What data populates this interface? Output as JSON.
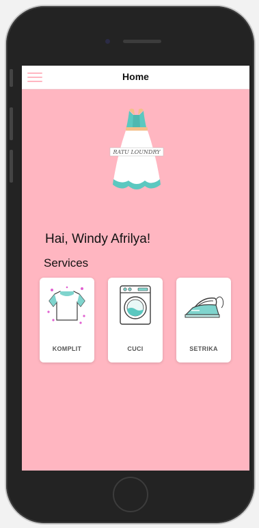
{
  "header": {
    "title": "Home",
    "menu_icon": "hamburger-icon"
  },
  "logo": {
    "text": "RATU LOUNDRY",
    "icon": "dress-logo-icon"
  },
  "greeting": "Hai, Windy Afrilya!",
  "services": {
    "title": "Services",
    "items": [
      {
        "label": "KOMPLIT",
        "icon": "tshirt-icon"
      },
      {
        "label": "CUCI",
        "icon": "washing-machine-icon"
      },
      {
        "label": "SETRIKA",
        "icon": "iron-icon"
      }
    ]
  },
  "colors": {
    "background": "#ffb6c1",
    "accent": "#5bc8c0",
    "header_bg": "#ffffff"
  }
}
